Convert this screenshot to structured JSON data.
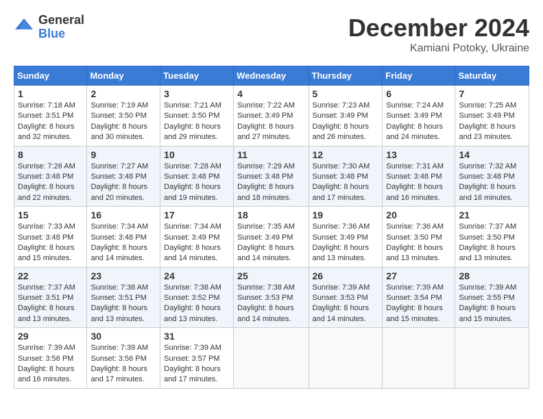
{
  "header": {
    "logo_general": "General",
    "logo_blue": "Blue",
    "month": "December 2024",
    "location": "Kamiani Potoky, Ukraine"
  },
  "days_of_week": [
    "Sunday",
    "Monday",
    "Tuesday",
    "Wednesday",
    "Thursday",
    "Friday",
    "Saturday"
  ],
  "weeks": [
    [
      {
        "day": "1",
        "sunrise": "7:18 AM",
        "sunset": "3:51 PM",
        "daylight_h": "8",
        "daylight_m": "32"
      },
      {
        "day": "2",
        "sunrise": "7:19 AM",
        "sunset": "3:50 PM",
        "daylight_h": "8",
        "daylight_m": "30"
      },
      {
        "day": "3",
        "sunrise": "7:21 AM",
        "sunset": "3:50 PM",
        "daylight_h": "8",
        "daylight_m": "29"
      },
      {
        "day": "4",
        "sunrise": "7:22 AM",
        "sunset": "3:49 PM",
        "daylight_h": "8",
        "daylight_m": "27"
      },
      {
        "day": "5",
        "sunrise": "7:23 AM",
        "sunset": "3:49 PM",
        "daylight_h": "8",
        "daylight_m": "26"
      },
      {
        "day": "6",
        "sunrise": "7:24 AM",
        "sunset": "3:49 PM",
        "daylight_h": "8",
        "daylight_m": "24"
      },
      {
        "day": "7",
        "sunrise": "7:25 AM",
        "sunset": "3:49 PM",
        "daylight_h": "8",
        "daylight_m": "23"
      }
    ],
    [
      {
        "day": "8",
        "sunrise": "7:26 AM",
        "sunset": "3:48 PM",
        "daylight_h": "8",
        "daylight_m": "22"
      },
      {
        "day": "9",
        "sunrise": "7:27 AM",
        "sunset": "3:48 PM",
        "daylight_h": "8",
        "daylight_m": "20"
      },
      {
        "day": "10",
        "sunrise": "7:28 AM",
        "sunset": "3:48 PM",
        "daylight_h": "8",
        "daylight_m": "19"
      },
      {
        "day": "11",
        "sunrise": "7:29 AM",
        "sunset": "3:48 PM",
        "daylight_h": "8",
        "daylight_m": "18"
      },
      {
        "day": "12",
        "sunrise": "7:30 AM",
        "sunset": "3:48 PM",
        "daylight_h": "8",
        "daylight_m": "17"
      },
      {
        "day": "13",
        "sunrise": "7:31 AM",
        "sunset": "3:48 PM",
        "daylight_h": "8",
        "daylight_m": "16"
      },
      {
        "day": "14",
        "sunrise": "7:32 AM",
        "sunset": "3:48 PM",
        "daylight_h": "8",
        "daylight_m": "16"
      }
    ],
    [
      {
        "day": "15",
        "sunrise": "7:33 AM",
        "sunset": "3:48 PM",
        "daylight_h": "8",
        "daylight_m": "15"
      },
      {
        "day": "16",
        "sunrise": "7:34 AM",
        "sunset": "3:48 PM",
        "daylight_h": "8",
        "daylight_m": "14"
      },
      {
        "day": "17",
        "sunrise": "7:34 AM",
        "sunset": "3:49 PM",
        "daylight_h": "8",
        "daylight_m": "14"
      },
      {
        "day": "18",
        "sunrise": "7:35 AM",
        "sunset": "3:49 PM",
        "daylight_h": "8",
        "daylight_m": "14"
      },
      {
        "day": "19",
        "sunrise": "7:36 AM",
        "sunset": "3:49 PM",
        "daylight_h": "8",
        "daylight_m": "13"
      },
      {
        "day": "20",
        "sunrise": "7:36 AM",
        "sunset": "3:50 PM",
        "daylight_h": "8",
        "daylight_m": "13"
      },
      {
        "day": "21",
        "sunrise": "7:37 AM",
        "sunset": "3:50 PM",
        "daylight_h": "8",
        "daylight_m": "13"
      }
    ],
    [
      {
        "day": "22",
        "sunrise": "7:37 AM",
        "sunset": "3:51 PM",
        "daylight_h": "8",
        "daylight_m": "13"
      },
      {
        "day": "23",
        "sunrise": "7:38 AM",
        "sunset": "3:51 PM",
        "daylight_h": "8",
        "daylight_m": "13"
      },
      {
        "day": "24",
        "sunrise": "7:38 AM",
        "sunset": "3:52 PM",
        "daylight_h": "8",
        "daylight_m": "13"
      },
      {
        "day": "25",
        "sunrise": "7:38 AM",
        "sunset": "3:53 PM",
        "daylight_h": "8",
        "daylight_m": "14"
      },
      {
        "day": "26",
        "sunrise": "7:39 AM",
        "sunset": "3:53 PM",
        "daylight_h": "8",
        "daylight_m": "14"
      },
      {
        "day": "27",
        "sunrise": "7:39 AM",
        "sunset": "3:54 PM",
        "daylight_h": "8",
        "daylight_m": "15"
      },
      {
        "day": "28",
        "sunrise": "7:39 AM",
        "sunset": "3:55 PM",
        "daylight_h": "8",
        "daylight_m": "15"
      }
    ],
    [
      {
        "day": "29",
        "sunrise": "7:39 AM",
        "sunset": "3:56 PM",
        "daylight_h": "8",
        "daylight_m": "16"
      },
      {
        "day": "30",
        "sunrise": "7:39 AM",
        "sunset": "3:56 PM",
        "daylight_h": "8",
        "daylight_m": "17"
      },
      {
        "day": "31",
        "sunrise": "7:39 AM",
        "sunset": "3:57 PM",
        "daylight_h": "8",
        "daylight_m": "17"
      },
      null,
      null,
      null,
      null
    ]
  ],
  "labels": {
    "sunrise": "Sunrise:",
    "sunset": "Sunset:",
    "daylight": "Daylight:"
  }
}
